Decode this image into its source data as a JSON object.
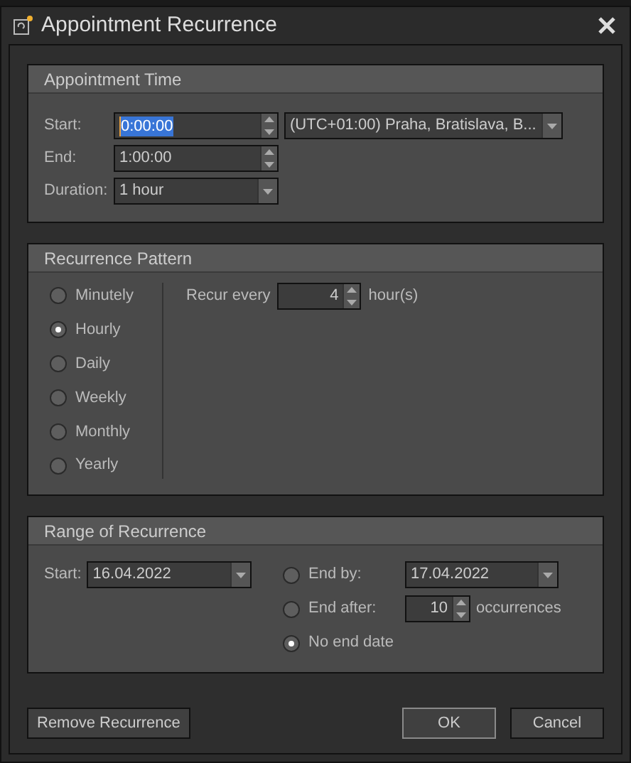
{
  "window": {
    "title": "Appointment Recurrence"
  },
  "appointment_time": {
    "title": "Appointment Time",
    "start": {
      "label": "Start:",
      "value": "0:00:00",
      "text_selected": true
    },
    "timezone": {
      "value": "(UTC+01:00) Praha, Bratislava, B..."
    },
    "end": {
      "label": "End:",
      "value": "1:00:00",
      "text_selected": false
    },
    "duration": {
      "label": "Duration:",
      "value": "1 hour"
    }
  },
  "recurrence_pattern": {
    "title": "Recurrence Pattern",
    "options": [
      {
        "label": "Minutely",
        "selected": false
      },
      {
        "label": "Hourly",
        "selected": true
      },
      {
        "label": "Daily",
        "selected": false
      },
      {
        "label": "Weekly",
        "selected": false
      },
      {
        "label": "Monthly",
        "selected": false
      },
      {
        "label": "Yearly",
        "selected": false
      }
    ],
    "recur_label": "Recur every",
    "interval": "4",
    "unit": "hour(s)"
  },
  "range": {
    "title": "Range of Recurrence",
    "start": {
      "label": "Start:",
      "value": "16.04.2022"
    },
    "end_options": [
      {
        "kind": "date",
        "label": "End by:",
        "selected": false,
        "value": "17.04.2022"
      },
      {
        "kind": "count",
        "label": "End after:",
        "selected": false,
        "value": "10",
        "suffix": "occurrences"
      },
      {
        "kind": "none",
        "label": "No end date",
        "selected": true
      }
    ]
  },
  "buttons": [
    {
      "label": "Remove Recurrence",
      "default": false
    },
    {
      "label": "OK",
      "default": true
    },
    {
      "label": "Cancel",
      "default": false
    }
  ]
}
